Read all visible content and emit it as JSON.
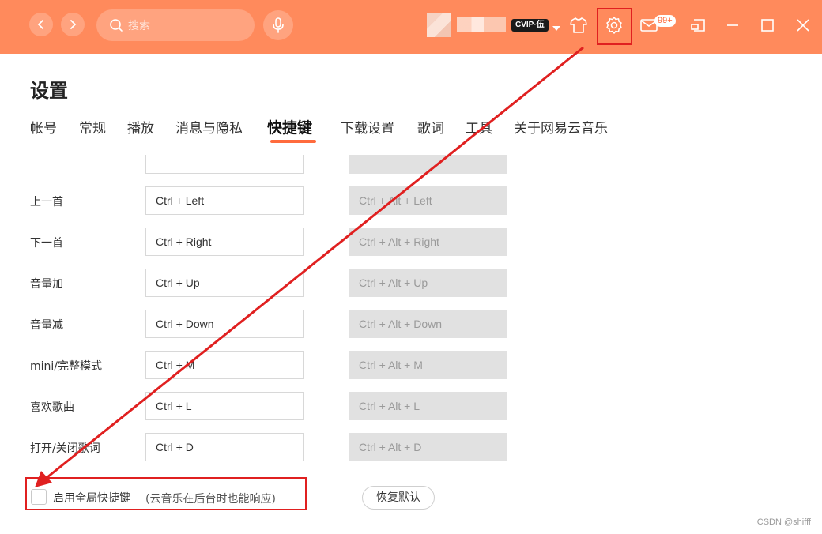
{
  "titlebar": {
    "search_placeholder": "搜索",
    "username": "",
    "vip_label": "CVIP·伍",
    "notification_count": "99+"
  },
  "settings": {
    "title": "设置",
    "tabs": [
      {
        "label": "帐号"
      },
      {
        "label": "常规"
      },
      {
        "label": "播放"
      },
      {
        "label": "消息与隐私"
      },
      {
        "label": "快捷键"
      },
      {
        "label": "下载设置"
      },
      {
        "label": "歌词"
      },
      {
        "label": "工具"
      },
      {
        "label": "关于网易云音乐"
      }
    ],
    "active_tab": "快捷键"
  },
  "shortcuts": {
    "rows": [
      {
        "label": "上一首",
        "key": "Ctrl + Left",
        "global": "Ctrl + Alt + Left"
      },
      {
        "label": "下一首",
        "key": "Ctrl + Right",
        "global": "Ctrl + Alt + Right"
      },
      {
        "label": "音量加",
        "key": "Ctrl + Up",
        "global": "Ctrl + Alt + Up"
      },
      {
        "label": "音量减",
        "key": "Ctrl + Down",
        "global": "Ctrl + Alt + Down"
      },
      {
        "label": "mini/完整模式",
        "key": "Ctrl + M",
        "global": "Ctrl + Alt + M"
      },
      {
        "label": "喜欢歌曲",
        "key": "Ctrl + L",
        "global": "Ctrl + Alt + L"
      },
      {
        "label": "打开/关闭歌词",
        "key": "Ctrl + D",
        "global": "Ctrl + Alt + D"
      }
    ],
    "global_enable_label": "启用全局快捷键",
    "global_enable_note": "(云音乐在后台时也能响应)",
    "global_enabled": false,
    "restore_default_label": "恢复默认"
  },
  "watermark": "CSDN @shifff",
  "colors": {
    "brand": "#ff8a5c",
    "accent": "#ff6b3d",
    "annotation": "#e02020"
  },
  "icons": [
    "chevron-left-icon",
    "chevron-right-icon",
    "search-icon",
    "microphone-icon",
    "chevron-down-icon",
    "tshirt-icon",
    "gear-icon",
    "mail-icon",
    "mini-player-icon",
    "minimize-icon",
    "maximize-icon",
    "close-icon"
  ]
}
